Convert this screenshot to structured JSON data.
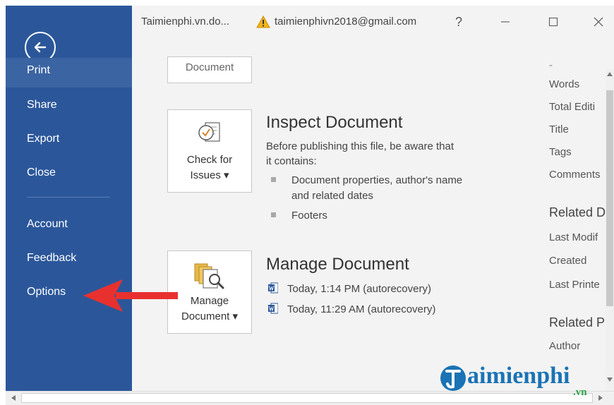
{
  "sidebar": {
    "items": [
      {
        "label": "Print"
      },
      {
        "label": "Share"
      },
      {
        "label": "Export"
      },
      {
        "label": "Close"
      },
      {
        "label": "Account"
      },
      {
        "label": "Feedback"
      },
      {
        "label": "Options"
      }
    ],
    "color": "#2b579a"
  },
  "titlebar": {
    "file_name": "Taimienphi.vn.do...",
    "account": "taimienphivn2018@gmail.com",
    "help": "?"
  },
  "cards": {
    "top_partial_label": "Document",
    "check": {
      "line1": "Check for",
      "line2": "Issues ▾"
    },
    "manage": {
      "line1": "Manage",
      "line2": "Document ▾"
    }
  },
  "inspect": {
    "title": "Inspect Document",
    "desc_line1": "Before publishing this file, be aware that",
    "desc_line2": "it contains:",
    "bullets": [
      {
        "line1": "Document properties, author's name",
        "line2": "and related dates"
      },
      {
        "line1": "Footers"
      }
    ]
  },
  "manage": {
    "title": "Manage Document",
    "versions": [
      "Today, 1:14 PM (autorecovery)",
      "Today, 11:29 AM (autorecovery)"
    ]
  },
  "properties": {
    "rows": [
      "Words",
      "Total Editi",
      "Title",
      "Tags",
      "Comments"
    ],
    "related_dates_header": "Related D",
    "date_rows": [
      "Last Modif",
      "Created",
      "Last Printe"
    ],
    "related_people_header": "Related P",
    "people_rows": [
      "Author"
    ]
  },
  "watermark": {
    "text": "aimienphi",
    "suffix": ".vn"
  },
  "colors": {
    "arrow": "#e8312f",
    "accent": "#2b579a",
    "logo": "#1a73b5"
  }
}
